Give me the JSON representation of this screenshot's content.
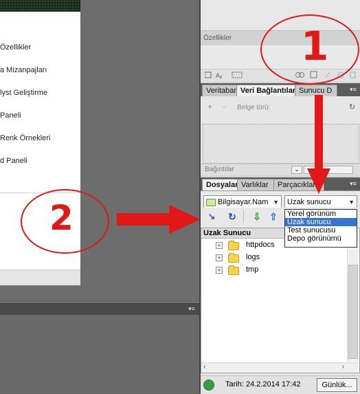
{
  "welcome": {
    "items": [
      "Özellikler",
      "a Mizanpajları",
      "lyst Geliştirme",
      "Paneli",
      "Renk Örnekleri",
      "d Paneli"
    ]
  },
  "properties_panel": {
    "title": "Özellikler"
  },
  "db_panel": {
    "tabs": [
      "Veritaban",
      "Veri Bağlantıları",
      "Sunucu D"
    ],
    "active_tab": "Veri Bağlantıları",
    "belge_label": "Belge türü:",
    "footer_label": "Bağıntılar"
  },
  "files_panel": {
    "tabs": [
      "Dosyalar",
      "Varlıklar",
      "Parçacıklar"
    ],
    "active_tab": "Dosyalar",
    "site_select": "Bilgisayar.Nam",
    "view_select": "Uzak sunucu",
    "view_options": [
      "Yerel görünüm",
      "Uzak sunucu",
      "Test sunucusu",
      "Depo görünümü"
    ],
    "selected_option": "Uzak sunucu",
    "tree_header": "Uzak Sunucu",
    "folders": [
      "httpdocs",
      "logs",
      "tmp"
    ],
    "status_date": "Tarih: 24.2.2014 17:42",
    "log_button": "Günlük..."
  },
  "annotations": {
    "step1": "1",
    "step2": "2",
    "color": "#e01818"
  },
  "icons": [
    "globe-icon",
    "refresh-icon",
    "download-arrow-icon",
    "upload-arrow-icon",
    "folder-icon",
    "panel-menu-icon"
  ]
}
